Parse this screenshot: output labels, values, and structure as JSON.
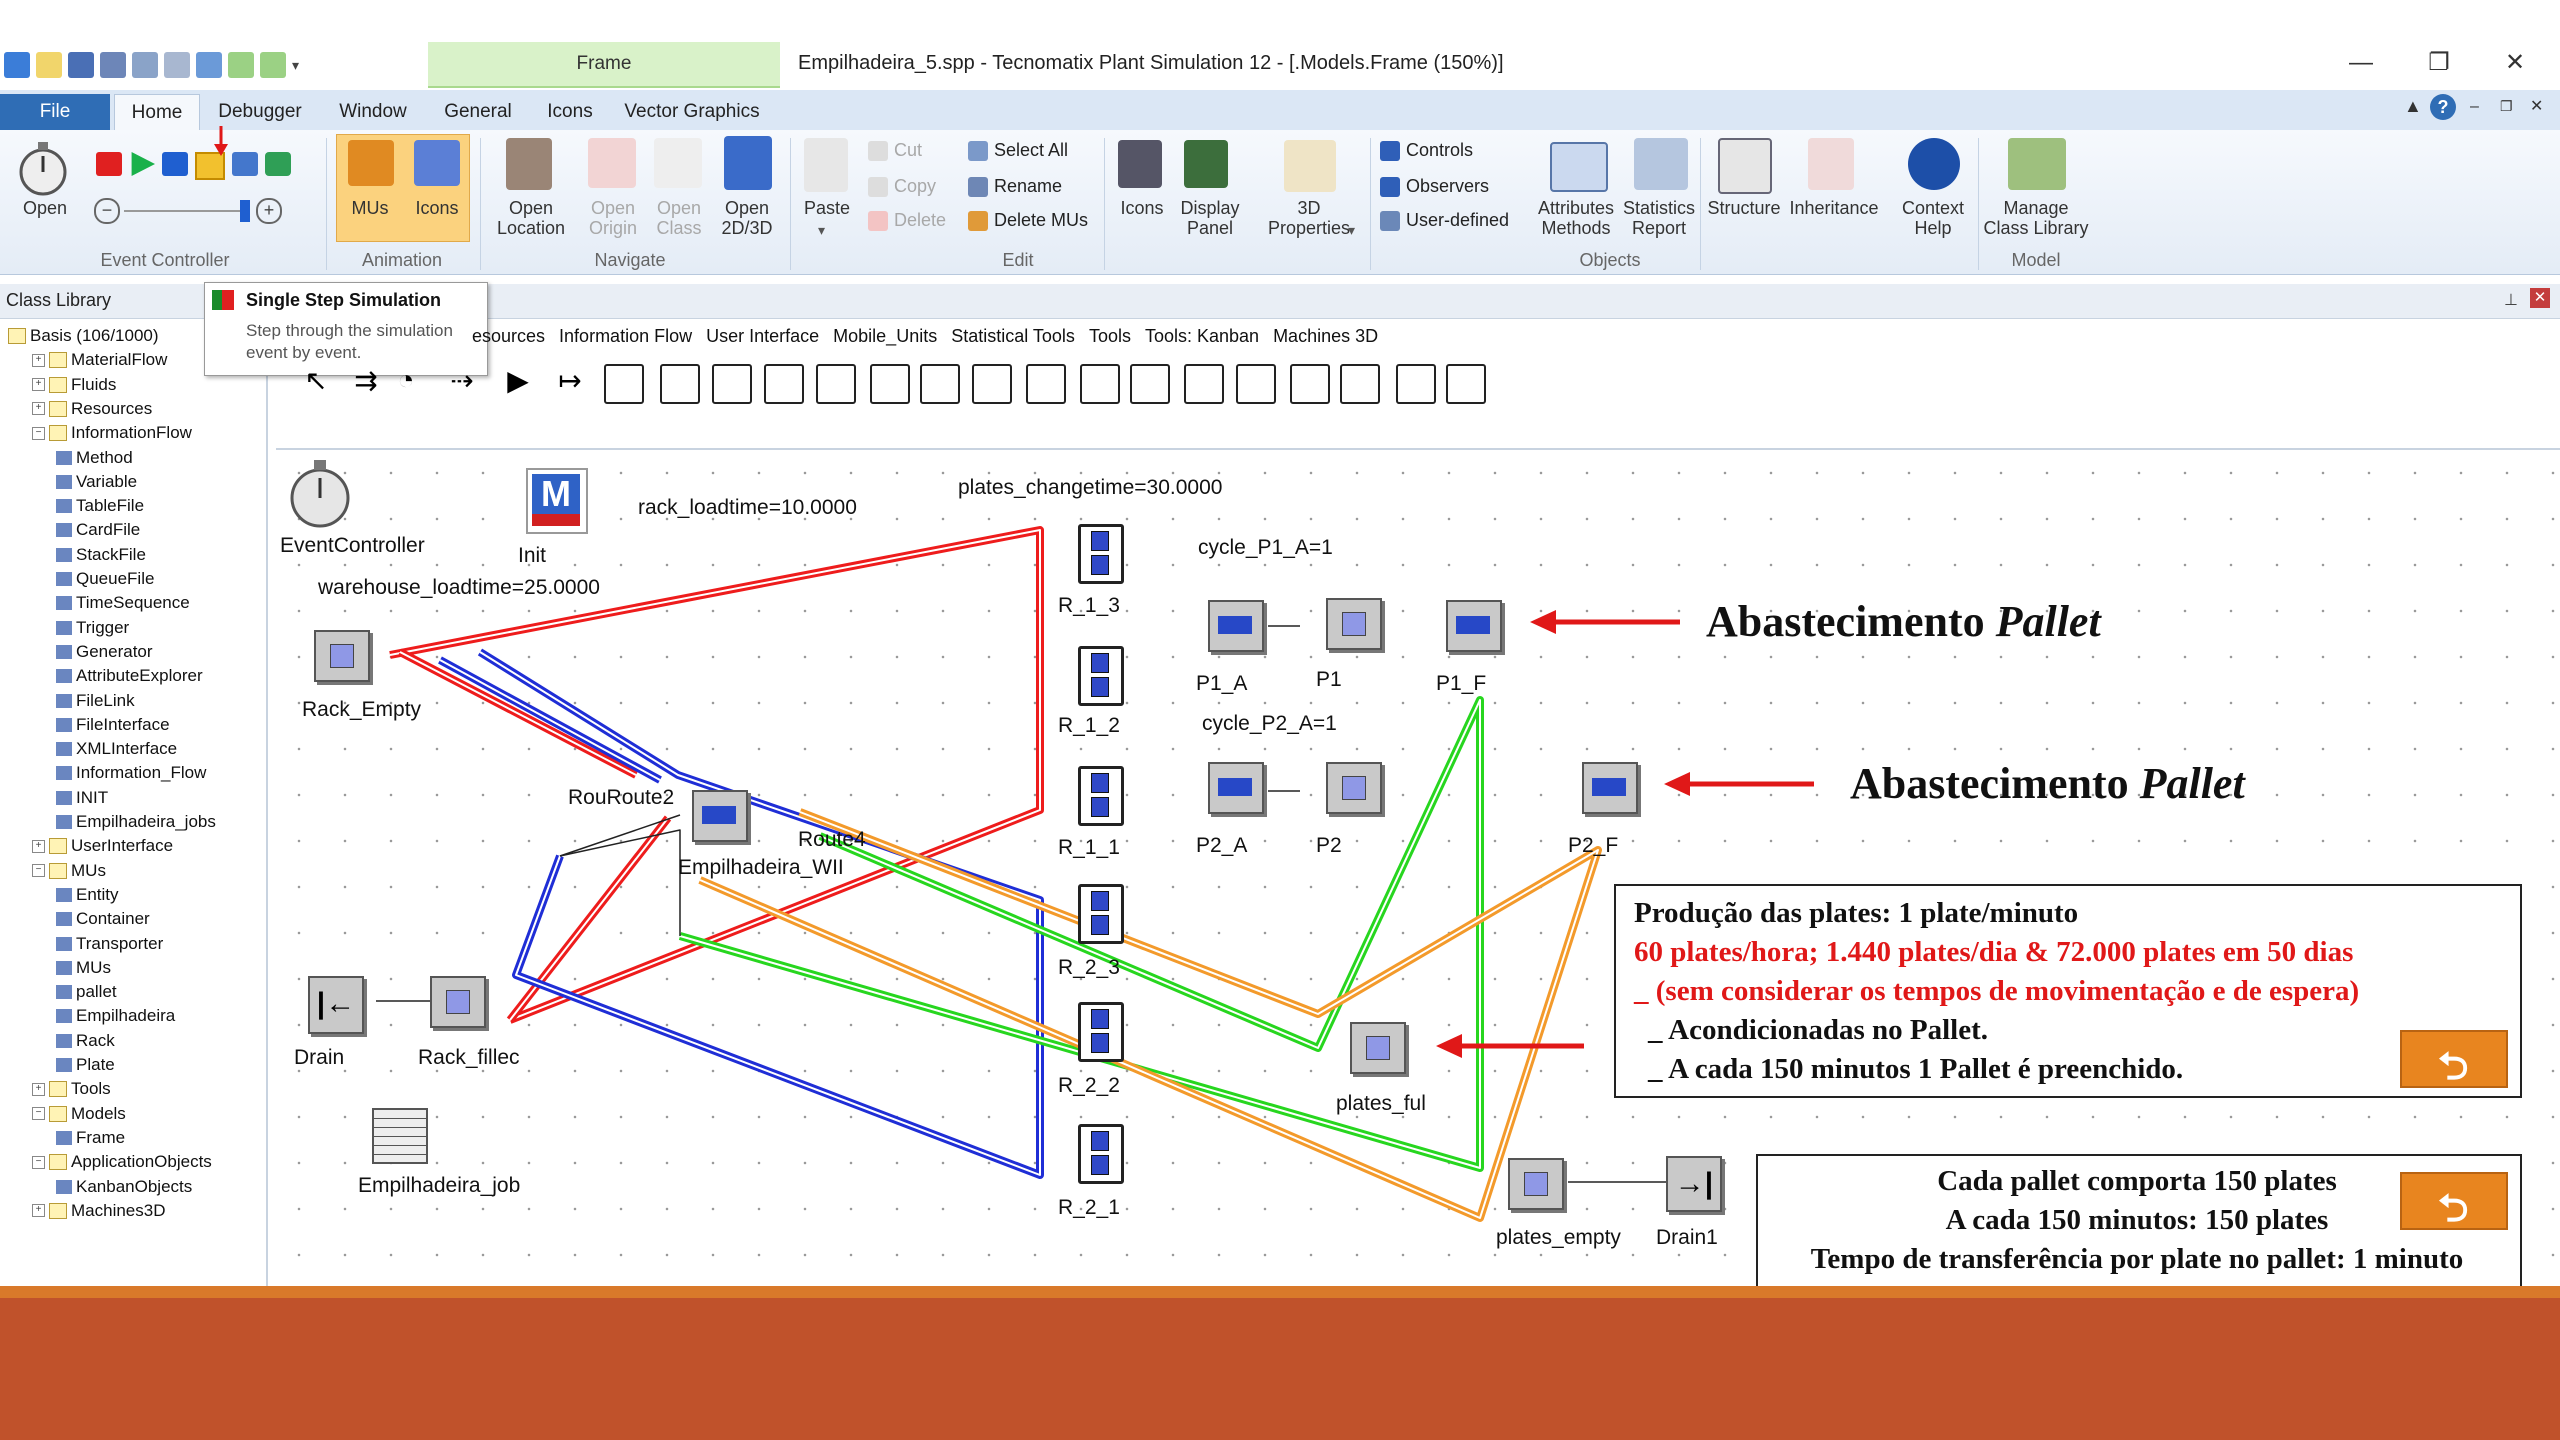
{
  "window": {
    "title": "Empilhadeira_5.spp - Tecnomatix Plant Simulation 12 - [.Models.Frame  (150%)]",
    "context_tab": "Frame",
    "controls": [
      "—",
      "❐",
      "✕"
    ]
  },
  "ribbon": {
    "tabs": [
      "File",
      "Home",
      "Debugger",
      "Window",
      "General",
      "Icons",
      "Vector Graphics"
    ],
    "active_tab": "Home",
    "groups": [
      {
        "label": "Event Controller",
        "buttons": [
          "Open"
        ]
      },
      {
        "label": "Animation",
        "buttons": [
          "MUs",
          "Icons"
        ]
      },
      {
        "label": "Navigate",
        "buttons": [
          "Open\nLocation",
          "Open\nOrigin",
          "Open\nClass",
          "Open\n2D/3D"
        ]
      },
      {
        "label": "Edit",
        "buttons": [
          "Paste",
          "Cut",
          "Copy",
          "Delete",
          "Select All",
          "Rename",
          "Delete MUs"
        ]
      },
      {
        "label": "",
        "buttons": [
          "Icons",
          "Display\nPanel",
          "3D\nProperties"
        ]
      },
      {
        "label": "Objects",
        "buttons": [
          "Controls",
          "Observers",
          "User-defined",
          "Attributes\nMethods",
          "Statistics\nReport"
        ]
      },
      {
        "label": "",
        "buttons": [
          "Structure",
          "Inheritance",
          "Context\nHelp"
        ]
      },
      {
        "label": "Model",
        "buttons": [
          "Manage\nClass Library"
        ]
      }
    ]
  },
  "tooltip": {
    "title": "Single Step Simulation",
    "body": "Step through the simulation event by event."
  },
  "class_library": {
    "title": "Class Library",
    "nodes": [
      "Basis (106/1000)",
      "MaterialFlow",
      "Fluids",
      "Resources",
      "InformationFlow",
      "Method",
      "Variable",
      "TableFile",
      "CardFile",
      "StackFile",
      "QueueFile",
      "TimeSequence",
      "Trigger",
      "Generator",
      "AttributeExplorer",
      "FileLink",
      "FileInterface",
      "XMLInterface",
      "Information_Flow",
      "INIT",
      "Empilhadeira_jobs",
      "UserInterface",
      "MUs",
      "Entity",
      "Container",
      "Transporter",
      "MUs",
      "pallet",
      "Empilhadeira",
      "Rack",
      "Plate",
      "Tools",
      "Models",
      "Frame",
      "ApplicationObjects",
      "KanbanObjects",
      "Machines3D"
    ]
  },
  "toolbox": {
    "tabs": [
      "esources",
      "Information Flow",
      "User Interface",
      "Mobile_Units",
      "Statistical Tools",
      "Tools",
      "Tools: Kanban",
      "Machines 3D"
    ]
  },
  "canvas": {
    "labels": {
      "event_controller": "EventController",
      "init": "Init",
      "rack_loadtime": "rack_loadtime=10.0000",
      "warehouse_loadtime": "warehouse_loadtime=25.0000",
      "plates_changetime": "plates_changetime=30.0000",
      "cycle_p1": "cycle_P1_A=1",
      "cycle_p2": "cycle_P2_A=1",
      "rack_empty": "Rack_Empty",
      "rouroute2": "RouRoute2",
      "route4": "Route4",
      "empilhadeira_wi": "Empilhadeira_WII",
      "drain": "Drain",
      "rack_filled": "Rack_fillec",
      "empilhadeira_job": "Empilhadeira_job",
      "r13": "R_1_3",
      "r12": "R_1_2",
      "r11": "R_1_1",
      "r23": "R_2_3",
      "r22": "R_2_2",
      "r21": "R_2_1",
      "p1a": "P1_A",
      "p1": "P1",
      "p1f": "P1_F",
      "p2a": "P2_A",
      "p2": "P2",
      "p2f": "P2_F",
      "plates_full": "plates_ful",
      "plates_empty": "plates_empty",
      "drain1": "Drain1"
    },
    "annotations": {
      "pallet1_text": "Abastecimento ",
      "pallet1_em": "Pallet",
      "pallet2_text": "Abastecimento ",
      "pallet2_em": "Pallet"
    },
    "box1": {
      "line1": "Produção das plates: 1 plate/minuto",
      "line2": "60 plates/hora; 1.440 plates/dia & 72.000 plates em 50 dias",
      "line3": "_ (sem considerar os tempos de movimentação e de espera)",
      "line4": "_ Acondicionadas no Pallet.",
      "line5": "_ A cada 150 minutos 1 Pallet é preenchido."
    },
    "box2": {
      "line1": "Cada pallet comporta 150 plates",
      "line2": "A cada 150 minutos: 150 plates",
      "line3": "Tempo de transferência por plate no pallet: 1 minuto"
    }
  },
  "colors": {
    "red": "#ee1c1c",
    "blue": "#1f2ed6",
    "green": "#27d61f",
    "orange": "#f39a2b",
    "band": "#c0522b"
  }
}
